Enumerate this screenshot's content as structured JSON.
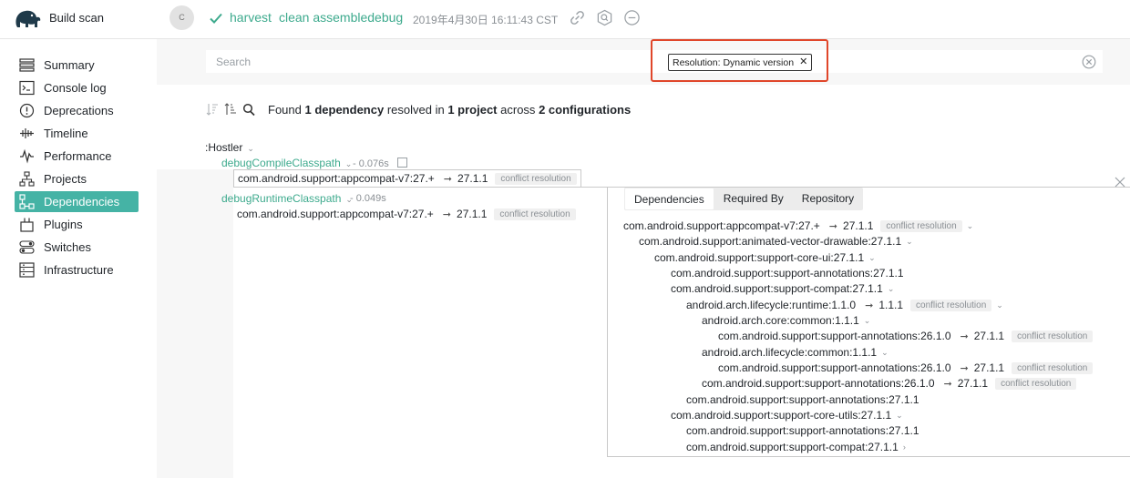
{
  "header": {
    "app_title": "Build scan",
    "avatar_initial": "C",
    "project": "harvest",
    "tasks": "clean assembledebug",
    "timestamp": "2019年4月30日 16:11:43 CST",
    "icons": [
      "link-icon",
      "search-badge-icon",
      "minus-circle-icon"
    ]
  },
  "sidebar": {
    "items": [
      {
        "label": "Summary",
        "icon": "summary-icon"
      },
      {
        "label": "Console log",
        "icon": "console-icon"
      },
      {
        "label": "Deprecations",
        "icon": "warning-icon"
      },
      {
        "label": "Timeline",
        "icon": "timeline-icon"
      },
      {
        "label": "Performance",
        "icon": "performance-icon"
      },
      {
        "label": "Projects",
        "icon": "projects-icon"
      },
      {
        "label": "Dependencies",
        "icon": "dependencies-icon",
        "active": true
      },
      {
        "label": "Plugins",
        "icon": "plugins-icon"
      },
      {
        "label": "Switches",
        "icon": "switches-icon"
      },
      {
        "label": "Infrastructure",
        "icon": "infrastructure-icon"
      }
    ]
  },
  "search": {
    "placeholder": "Search",
    "filter_chip": "Resolution: Dynamic version"
  },
  "summary": {
    "prefix": "Found",
    "dep_count": "1 dependency",
    "mid1": "resolved in",
    "project_count": "1 project",
    "mid2": "across",
    "config_count": "2 configurations"
  },
  "project": {
    "name": ":Hostler",
    "configurations": [
      {
        "name": "debugCompileClasspath",
        "duration": "- 0.076s",
        "dependency": "com.android.support:appcompat-v7:27.+",
        "resolved": "27.1.1",
        "badge": "conflict resolution"
      },
      {
        "name": "debugRuntimeClasspath",
        "duration": "- 0.049s",
        "dependency": "com.android.support:appcompat-v7:27.+",
        "resolved": "27.1.1",
        "badge": "conflict resolution"
      }
    ]
  },
  "panel": {
    "tabs": [
      "Dependencies",
      "Required By",
      "Repository"
    ],
    "active_tab": "Dependencies",
    "tree": [
      {
        "text": "com.android.support:appcompat-v7:27.+",
        "resolved": "27.1.1",
        "badge": "conflict resolution",
        "chev": "⌄"
      },
      {
        "text": "com.android.support:animated-vector-drawable:27.1.1",
        "chev": "⌄"
      },
      {
        "text": "com.android.support:support-core-ui:27.1.1",
        "chev": "⌄"
      },
      {
        "text": "com.android.support:support-annotations:27.1.1"
      },
      {
        "text": "com.android.support:support-compat:27.1.1",
        "chev": "⌄"
      },
      {
        "text": "android.arch.lifecycle:runtime:1.1.0",
        "resolved": "1.1.1",
        "badge": "conflict resolution",
        "chev": "⌄"
      },
      {
        "text": "android.arch.core:common:1.1.1",
        "chev": "⌄"
      },
      {
        "text": "com.android.support:support-annotations:26.1.0",
        "resolved": "27.1.1",
        "badge": "conflict resolution"
      },
      {
        "text": "android.arch.lifecycle:common:1.1.1",
        "chev": "⌄"
      },
      {
        "text": "com.android.support:support-annotations:26.1.0",
        "resolved": "27.1.1",
        "badge": "conflict resolution"
      },
      {
        "text": "com.android.support:support-annotations:26.1.0",
        "resolved": "27.1.1",
        "badge": "conflict resolution"
      },
      {
        "text": "com.android.support:support-annotations:27.1.1"
      },
      {
        "text": "com.android.support:support-core-utils:27.1.1",
        "chev": "⌄"
      },
      {
        "text": "com.android.support:support-annotations:27.1.1"
      },
      {
        "text": "com.android.support:support-compat:27.1.1",
        "chev": "›"
      }
    ]
  }
}
